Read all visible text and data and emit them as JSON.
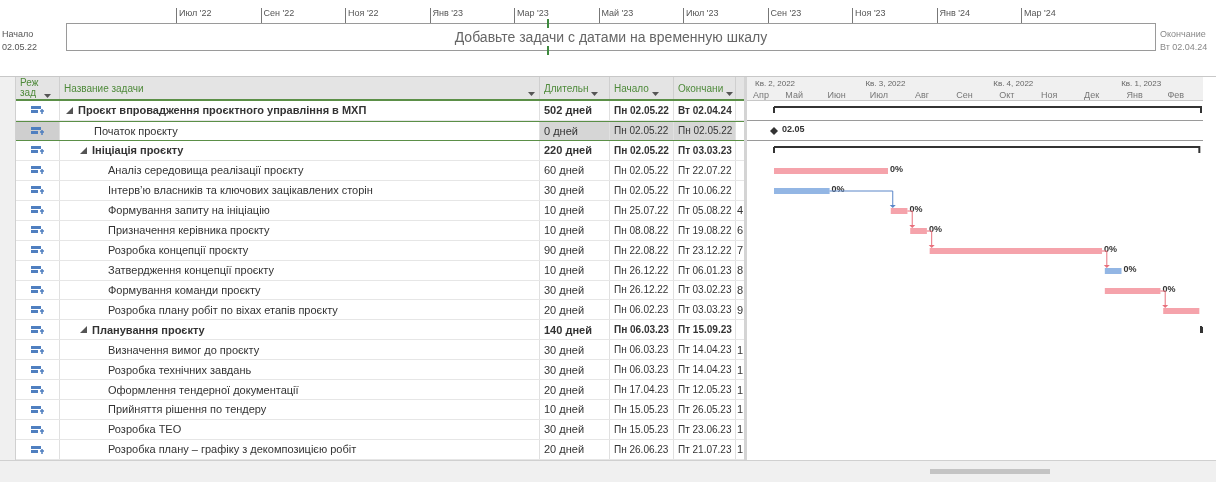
{
  "timeline": {
    "start_label": "Начало",
    "start_date": "02.05.22",
    "end_label": "Окончание",
    "end_date": "Вт 02.04.24",
    "message": "Добавьте задачи с датами на временную шкалу",
    "ticks": [
      "Июл '22",
      "Сен '22",
      "Ноя '22",
      "Янв '23",
      "Мар '23",
      "Май '23",
      "Июл '23",
      "Сен '23",
      "Ноя '23",
      "Янв '24",
      "Мар '24"
    ]
  },
  "columns": [
    "Реж зад",
    "Название задачи",
    "Длительн",
    "Начало",
    "Окончани"
  ],
  "gantt": {
    "quarters": [
      "Кв. 2, 2022",
      "Кв. 3, 2022",
      "Кв. 4, 2022",
      "Кв. 1, 2023"
    ],
    "months": [
      "Апр",
      "Май",
      "Июн",
      "Июл",
      "Авг",
      "Сен",
      "Окт",
      "Ноя",
      "Дек",
      "Янв",
      "Фев"
    ]
  },
  "tasks": [
    {
      "kind": "summary",
      "name": "Проєкт впровадження проєктного управління в МХП",
      "duration": "502 дней",
      "start": "Пн 02.05.22",
      "end": "Вт 02.04.24",
      "selected": false,
      "expanded": true,
      "children": [
        {
          "kind": "milestone",
          "name": "Початок проєкту",
          "duration": "0 дней",
          "start": "Пн 02.05.22",
          "end": "Пн 02.05.22",
          "selected": true,
          "bar_label": "02.05"
        },
        {
          "kind": "summary",
          "name": "Ініціація проєкту",
          "duration": "220 дней",
          "start": "Пн 02.05.22",
          "end": "Пт 03.03.23",
          "selected": false,
          "expanded": true,
          "children": [
            {
              "kind": "task",
              "name": "Аналіз середовища реалізації проєкту",
              "duration": "60 дней",
              "start": "Пн 02.05.22",
              "end": "Пт 22.07.22",
              "selected": false,
              "critical": true,
              "bar_label": "0%"
            },
            {
              "kind": "task",
              "name": "Інтерв’ю власників та ключових зацікавлених сторін",
              "duration": "30 дней",
              "start": "Пн 02.05.22",
              "end": "Пт 10.06.22",
              "selected": false,
              "critical": false,
              "bar_label": "0%"
            },
            {
              "kind": "task",
              "name": "Формування запиту на ініціацію",
              "duration": "10 дней",
              "start": "Пн 25.07.22",
              "end": "Пт 05.08.22",
              "column_5": "4",
              "selected": false,
              "critical": true,
              "bar_label": "0%"
            },
            {
              "kind": "task",
              "name": "Призначення керівника проєкту",
              "duration": "10 дней",
              "start": "Пн 08.08.22",
              "end": "Пт 19.08.22",
              "column_5": "6",
              "selected": false,
              "critical": true,
              "bar_label": "0%"
            },
            {
              "kind": "task",
              "name": "Розробка концепції проєкту",
              "duration": "90 дней",
              "start": "Пн 22.08.22",
              "end": "Пт 23.12.22",
              "column_5": "7",
              "selected": false,
              "critical": true,
              "bar_label": "0%"
            },
            {
              "kind": "task",
              "name": "Затвердження концепції проєкту",
              "duration": "10 дней",
              "start": "Пн 26.12.22",
              "end": "Пт 06.01.23",
              "column_5": "8",
              "selected": false,
              "critical": false,
              "bar_label": "0%"
            },
            {
              "kind": "task",
              "name": "Формування команди проєкту",
              "duration": "30 дней",
              "start": "Пн 26.12.22",
              "end": "Пт 03.02.23",
              "column_5": "8",
              "selected": false,
              "critical": true,
              "bar_label": "0%"
            },
            {
              "kind": "task",
              "name": "Розробка плану робіт по віхах етапів проєкту",
              "duration": "20 дней",
              "start": "Пн 06.02.23",
              "end": "Пт 03.03.23",
              "column_5": "9",
              "selected": false,
              "critical": true
            }
          ]
        },
        {
          "kind": "summary",
          "name": "Планування проєкту",
          "duration": "140 дней",
          "start": "Пн 06.03.23",
          "end": "Пт 15.09.23",
          "selected": false,
          "expanded": true,
          "children": [
            {
              "kind": "task",
              "name": "Визначення вимог до проєкту",
              "duration": "30 дней",
              "start": "Пн 06.03.23",
              "end": "Пт 14.04.23",
              "column_5": "1",
              "selected": false
            },
            {
              "kind": "task",
              "name": "Розробка технічних завдань",
              "duration": "30 дней",
              "start": "Пн 06.03.23",
              "end": "Пт 14.04.23",
              "column_5": "1",
              "selected": false
            },
            {
              "kind": "task",
              "name": "Оформлення тендерної документації",
              "duration": "20 дней",
              "start": "Пн 17.04.23",
              "end": "Пт 12.05.23",
              "column_5": "1",
              "selected": false
            },
            {
              "kind": "task",
              "name": "Прийняття рішення по тендеру",
              "duration": "10 дней",
              "start": "Пн 15.05.23",
              "end": "Пт 26.05.23",
              "column_5": "1",
              "selected": false
            },
            {
              "kind": "task",
              "name": "Розробка ТЕО",
              "duration": "30 дней",
              "start": "Пн 15.05.23",
              "end": "Пт 23.06.23",
              "column_5": "1",
              "selected": false
            },
            {
              "kind": "task",
              "name": "Розробка плану – графіку з декомпозицією робіт",
              "duration": "20 дней",
              "start": "Пн 26.06.23",
              "end": "Пт 21.07.23",
              "column_5": "1",
              "selected": false
            }
          ]
        }
      ]
    }
  ]
}
